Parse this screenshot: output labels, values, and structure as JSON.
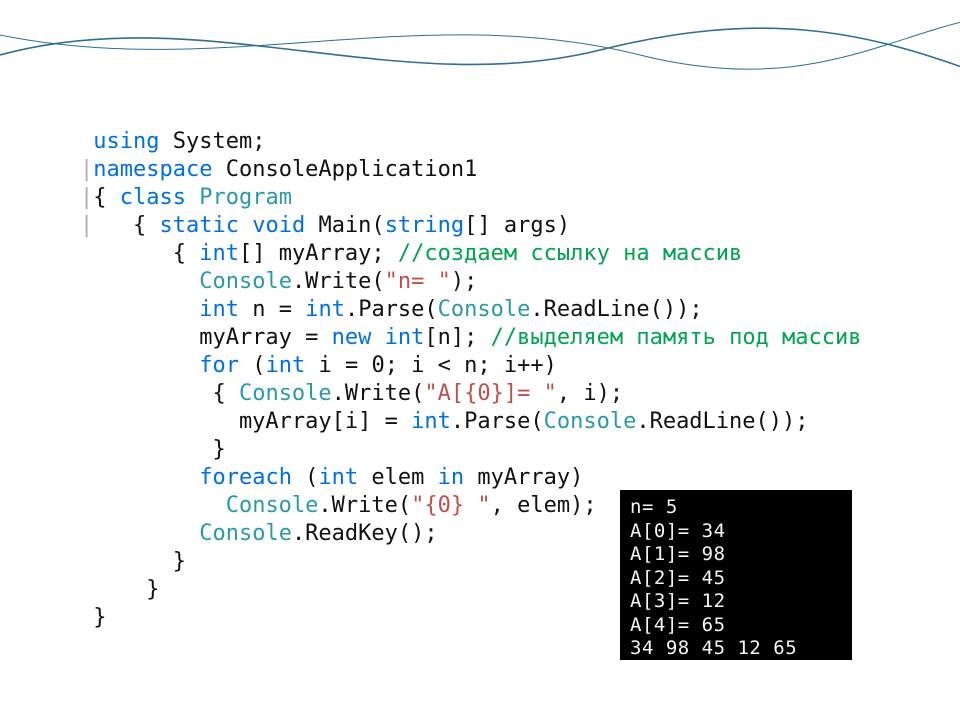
{
  "code": {
    "l1_kw1": "using",
    "l1_t1": " System;",
    "l2_gray": "|",
    "l2_kw": "namespace",
    "l2_t": " ConsoleApplication1",
    "l3_gray": "|",
    "l3_t1": "{ ",
    "l3_kw": "class",
    "l3_t2": " ",
    "l3_typ": "Program",
    "l4_gray": "|",
    "l4_t1": "   { ",
    "l4_kw1": "static",
    "l4_t2": " ",
    "l4_kw2": "void",
    "l4_t3": " Main(",
    "l4_kw3": "string",
    "l4_t4": "[] args)",
    "l5_t1": "       { ",
    "l5_kw": "int",
    "l5_t2": "[] myArray; ",
    "l5_com": "//создаем ссылку на массив",
    "l6_t1": "         ",
    "l6_typ": "Console",
    "l6_t2": ".Write(",
    "l6_str": "\"n= \"",
    "l6_t3": ");",
    "l7_t1": "         ",
    "l7_kw1": "int",
    "l7_t2": " n = ",
    "l7_kw2": "int",
    "l7_t3": ".Parse(",
    "l7_typ": "Console",
    "l7_t4": ".ReadLine());",
    "l8_t1": "         myArray = ",
    "l8_kw1": "new",
    "l8_t2": " ",
    "l8_kw2": "int",
    "l8_t3": "[n]; ",
    "l8_com": "//выделяем память под массив",
    "l9_t1": "         ",
    "l9_kw1": "for",
    "l9_t2": " (",
    "l9_kw2": "int",
    "l9_t3": " i = 0; i < n; i++)",
    "l10_t1": "          { ",
    "l10_typ": "Console",
    "l10_t2": ".Write(",
    "l10_str": "\"A[{0}]= \"",
    "l10_t3": ", i);",
    "l11_t1": "            myArray[i] = ",
    "l11_kw": "int",
    "l11_t2": ".Parse(",
    "l11_typ": "Console",
    "l11_t3": ".ReadLine());",
    "l12_t": "          }",
    "l13_t1": "         ",
    "l13_kw1": "foreach",
    "l13_t2": " (",
    "l13_kw2": "int",
    "l13_t3": " elem ",
    "l13_kw3": "in",
    "l13_t4": " myArray)",
    "l14_t1": "           ",
    "l14_typ": "Console",
    "l14_t2": ".Write(",
    "l14_str": "\"{0} \"",
    "l14_t3": ", elem);",
    "l15_t1": "         ",
    "l15_typ": "Console",
    "l15_t2": ".ReadKey();",
    "l16_t": "       }",
    "l17_t": "     }",
    "l18_t": " }"
  },
  "console": {
    "l1": "n= 5",
    "l2": "A[0]= 34",
    "l3": "A[1]= 98",
    "l4": "A[2]= 45",
    "l5": "A[3]= 12",
    "l6": "A[4]= 65",
    "l7": "34 98 45 12 65"
  }
}
